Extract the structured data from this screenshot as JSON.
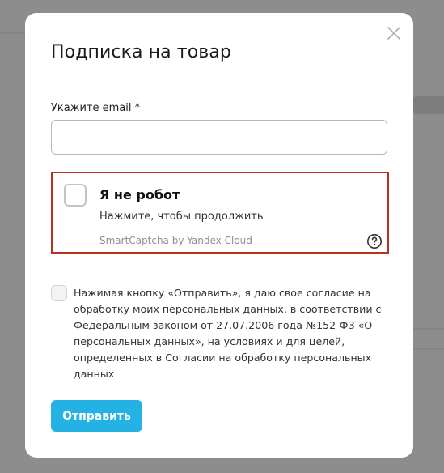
{
  "modal": {
    "title": "Подписка на товар",
    "close_icon": "close-icon"
  },
  "email": {
    "label": "Укажите email *",
    "value": "",
    "placeholder": ""
  },
  "captcha": {
    "title": "Я не робот",
    "subtitle": "Нажмите, чтобы продолжить",
    "brand": "SmartCaptcha by Yandex Cloud",
    "help_icon": "question-circle-icon",
    "border_color": "#b9311f"
  },
  "consent": {
    "text": "Нажимая кнопку «Отправить», я даю свое согласие на обработку моих персональных данных, в соответствии с Федеральным законом от 27.07.2006 года №152-ФЗ «О персональных данных», на условиях и для целей, определенных в Согласии на обработку персональных данных",
    "checked": false
  },
  "submit": {
    "label": "Отправить",
    "color": "#24b1e4"
  }
}
